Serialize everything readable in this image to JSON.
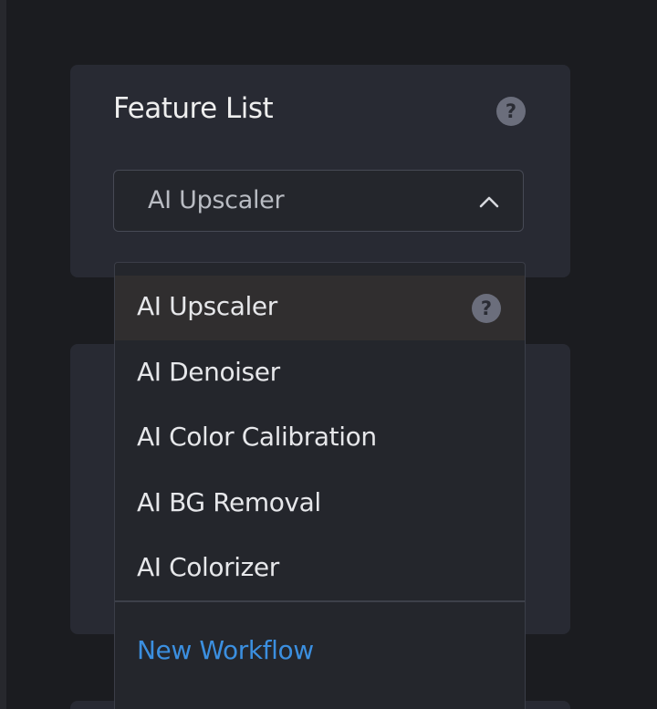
{
  "feature_panel": {
    "title": "Feature List",
    "help_symbol": "?",
    "select": {
      "value": "AI Upscaler",
      "state": "expanded",
      "chevron": "chevron-up-icon"
    }
  },
  "dropdown": {
    "items": [
      {
        "label": "AI Upscaler",
        "selected": true,
        "help_symbol": "?"
      },
      {
        "label": "AI Denoiser"
      },
      {
        "label": "AI Color Calibration"
      },
      {
        "label": "AI BG Removal"
      },
      {
        "label": "AI Colorizer"
      }
    ],
    "action": {
      "label": "New Workflow"
    }
  },
  "colors": {
    "background": "#1b1c20",
    "panel": "#282a33",
    "selected_row": "#302e2f",
    "accent_link": "#3b8fe0",
    "help_badge": "#6b6e7c"
  }
}
